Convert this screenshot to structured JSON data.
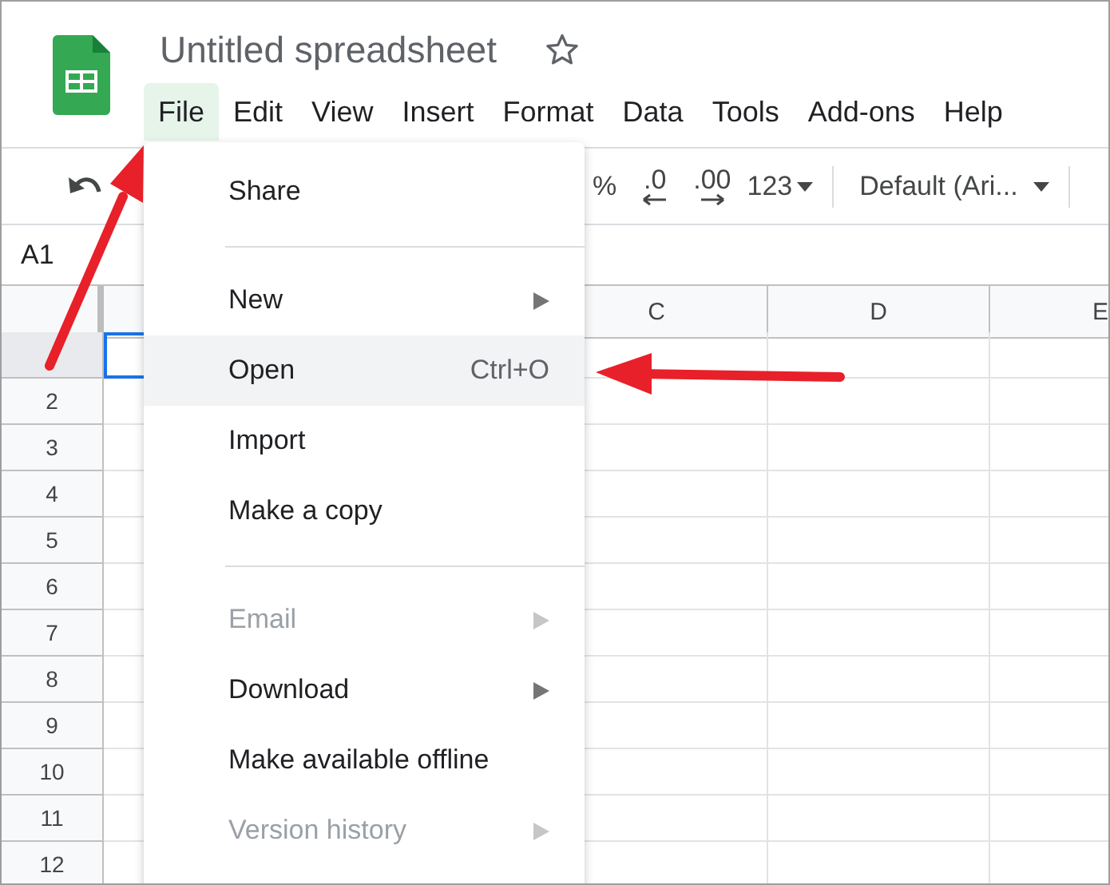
{
  "title": "Untitled spreadsheet",
  "menu_bar": [
    {
      "label": "File",
      "selected": true
    },
    {
      "label": "Edit",
      "selected": false
    },
    {
      "label": "View",
      "selected": false
    },
    {
      "label": "Insert",
      "selected": false
    },
    {
      "label": "Format",
      "selected": false
    },
    {
      "label": "Data",
      "selected": false
    },
    {
      "label": "Tools",
      "selected": false
    },
    {
      "label": "Add-ons",
      "selected": false
    },
    {
      "label": "Help",
      "selected": false
    }
  ],
  "toolbar": {
    "percent": "%",
    "decrease_decimal": ".0",
    "increase_decimal": ".00",
    "number_format": "123",
    "font": "Default (Ari..."
  },
  "name_box": "A1",
  "grid": {
    "columns": [
      "C",
      "D",
      "E"
    ],
    "rows": [
      "2",
      "3",
      "4",
      "5",
      "6",
      "7",
      "8",
      "9",
      "10",
      "11",
      "12"
    ]
  },
  "file_menu": {
    "items": [
      {
        "kind": "item",
        "label": "Share",
        "submenu": false,
        "disabled": false,
        "selected": false
      },
      {
        "kind": "separator"
      },
      {
        "kind": "item",
        "label": "New",
        "submenu": true,
        "disabled": false,
        "selected": false
      },
      {
        "kind": "item",
        "label": "Open",
        "shortcut": "Ctrl+O",
        "submenu": false,
        "disabled": false,
        "selected": true
      },
      {
        "kind": "item",
        "label": "Import",
        "submenu": false,
        "disabled": false,
        "selected": false
      },
      {
        "kind": "item",
        "label": "Make a copy",
        "submenu": false,
        "disabled": false,
        "selected": false
      },
      {
        "kind": "separator"
      },
      {
        "kind": "item",
        "label": "Email",
        "submenu": true,
        "disabled": true,
        "selected": false
      },
      {
        "kind": "item",
        "label": "Download",
        "submenu": true,
        "disabled": false,
        "selected": false
      },
      {
        "kind": "item",
        "label": "Make available offline",
        "submenu": false,
        "disabled": false,
        "selected": false
      },
      {
        "kind": "item",
        "label": "Version history",
        "submenu": true,
        "disabled": true,
        "selected": false
      }
    ]
  }
}
